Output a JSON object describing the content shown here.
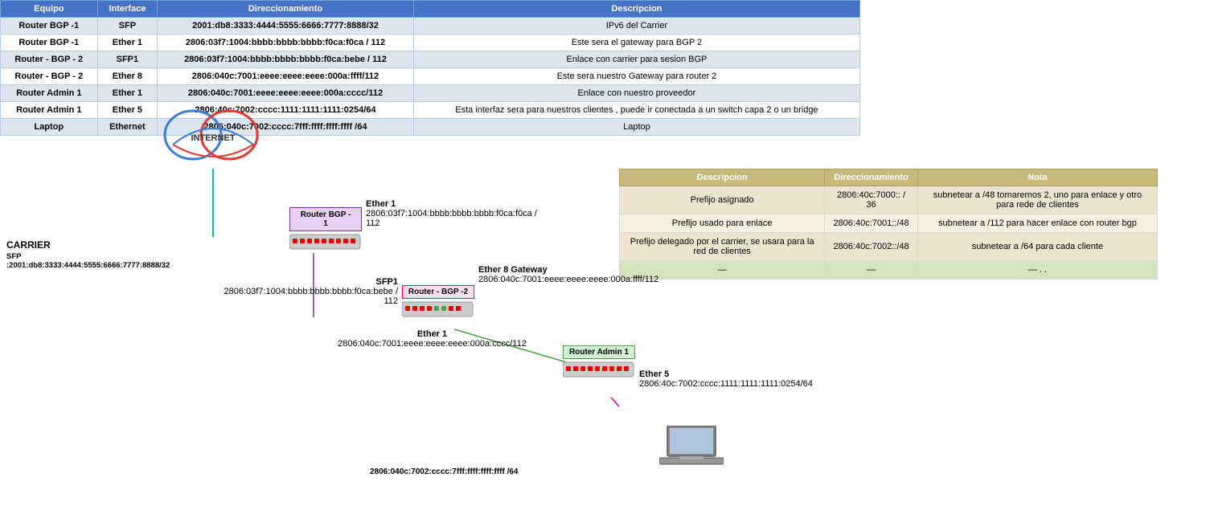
{
  "mainTable": {
    "headers": [
      "Equipo",
      "Interface",
      "Direccionamiento",
      "Descripcion"
    ],
    "rows": [
      {
        "equipo": "Router BGP -1",
        "interface": "SFP",
        "direccionamiento": "2001:db8:3333:4444:5555:6666:7777:8888/32",
        "descripcion": "IPv6 del Carrier"
      },
      {
        "equipo": "Router BGP -1",
        "interface": "Ether 1",
        "direccionamiento": "2806:03f7:1004:bbbb:bbbb:bbbb:f0ca:f0ca / 112",
        "descripcion": "Este sera el gateway para BGP 2"
      },
      {
        "equipo": "Router - BGP - 2",
        "interface": "SFP1",
        "direccionamiento": "2806:03f7:1004:bbbb:bbbb:bbbb:f0ca:bebe / 112",
        "descripcion": "Enlace con carrier para sesion BGP"
      },
      {
        "equipo": "Router - BGP - 2",
        "interface": "Ether 8",
        "direccionamiento": "2806:040c:7001:eeee:eeee:eeee:000a:ffff/112",
        "descripcion": "Este sera nuestro Gateway para router 2"
      },
      {
        "equipo": "Router Admin 1",
        "interface": "Ether 1",
        "direccionamiento": "2806:040c:7001:eeee:eeee:eeee:000a:cccc/112",
        "descripcion": "Enlace con nuestro proveedor"
      },
      {
        "equipo": "Router Admin 1",
        "interface": "Ether 5",
        "direccionamiento": "2806:40c:7002:cccc:1111:1111:1111:0254/64",
        "descripcion": "Esta interfaz sera para nuestros clientes , puede ir conectada a un switch capa 2 o un bridge"
      },
      {
        "equipo": "Laptop",
        "interface": "Ethernet",
        "direccionamiento": "2806:040c:7002:cccc:7fff:ffff:ffff:ffff /64",
        "descripcion": "Laptop"
      }
    ]
  },
  "secondTable": {
    "headers": [
      "Descripcion",
      "Direccionamiento",
      "Nota"
    ],
    "rows": [
      {
        "descripcion": "Prefijo asignado",
        "direccionamiento": "2806:40c:7000:: / 36",
        "nota": "subnetear a /48  tomaremos 2, uno para enlace y otro para rede de clientes"
      },
      {
        "descripcion": "Prefijo usado para enlace",
        "direccionamiento": "2806:40c:7001::/48",
        "nota": "subnetear a /112 para hacer enlace con router bgp"
      },
      {
        "descripcion": "Prefijo delegado por el carrier, se usara para la red de clientes",
        "direccionamiento": "2806:40c:7002::/48",
        "nota": "subnetear a /64 para cada cliente"
      },
      {
        "descripcion": "—",
        "direccionamiento": "—",
        "nota": "— . ."
      }
    ]
  },
  "diagram": {
    "internet": {
      "label": "INTERNET"
    },
    "carrier": {
      "label": "CARRIER",
      "sfp": "SFP :2001:db8:3333:4444:5555:6666:7777:8888/32"
    },
    "routerBGP1": {
      "label": "Router BGP -\n1",
      "ether1_label": "Ether 1",
      "ether1_addr": "2806:03f7:1004:bbbb:bbbb:bbbb:f0ca:f0ca / 112"
    },
    "routerBGP2": {
      "label": "Router - BGP -2",
      "sfp1_label": "SFP1",
      "sfp1_addr": "2806:03f7:1004:bbbb:bbbb:bbbb:f0ca:bebe / 112",
      "ether8_label": "Ether 8 Gateway",
      "ether8_addr": "2806:040c:7001:eeee:eeee:eeee:000a:ffff/112"
    },
    "routerAdmin1": {
      "label": "Router Admin 1",
      "ether1_label": "Ether 1",
      "ether1_addr": "2806:040c:7001:eeee:eeee:eeee:000a:cccc/112",
      "ether5_label": "Ether 5",
      "ether5_addr": "2806:40c:7002:cccc:1111:1111:1111:0254/64"
    },
    "laptop": {
      "label": "Laptop",
      "addr": "2806:040c:7002:cccc:7fff:ffff:ffff:ffff /64"
    }
  }
}
